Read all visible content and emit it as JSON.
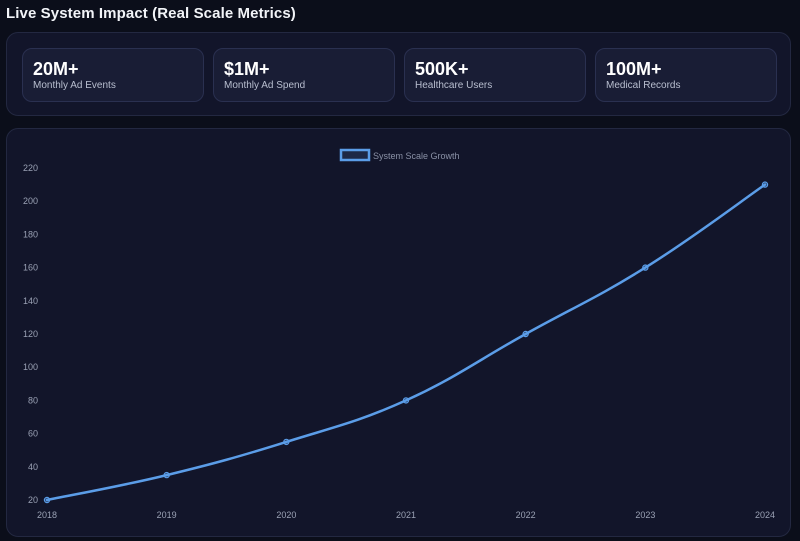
{
  "page": {
    "title": "Live System Impact (Real Scale Metrics)"
  },
  "metrics": [
    {
      "value": "20M+",
      "label": "Monthly Ad Events"
    },
    {
      "value": "$1M+",
      "label": "Monthly Ad Spend"
    },
    {
      "value": "500K+",
      "label": "Healthcare Users"
    },
    {
      "value": "100M+",
      "label": "Medical Records"
    }
  ],
  "colors": {
    "line": "#5b9de8",
    "background": "#0b0e1a",
    "panel": "#12152a"
  },
  "chart_data": {
    "type": "line",
    "title": "",
    "xlabel": "",
    "ylabel": "",
    "categories": [
      "2018",
      "2019",
      "2020",
      "2021",
      "2022",
      "2023",
      "2024"
    ],
    "series": [
      {
        "name": "System Scale Growth",
        "values": [
          20,
          35,
          55,
          80,
          120,
          160,
          210
        ]
      }
    ],
    "ylim": [
      20,
      220
    ],
    "yticks": [
      20,
      40,
      60,
      80,
      100,
      120,
      140,
      160,
      180,
      200,
      220
    ],
    "legend_position": "top-center",
    "grid": false,
    "smooth": true
  }
}
